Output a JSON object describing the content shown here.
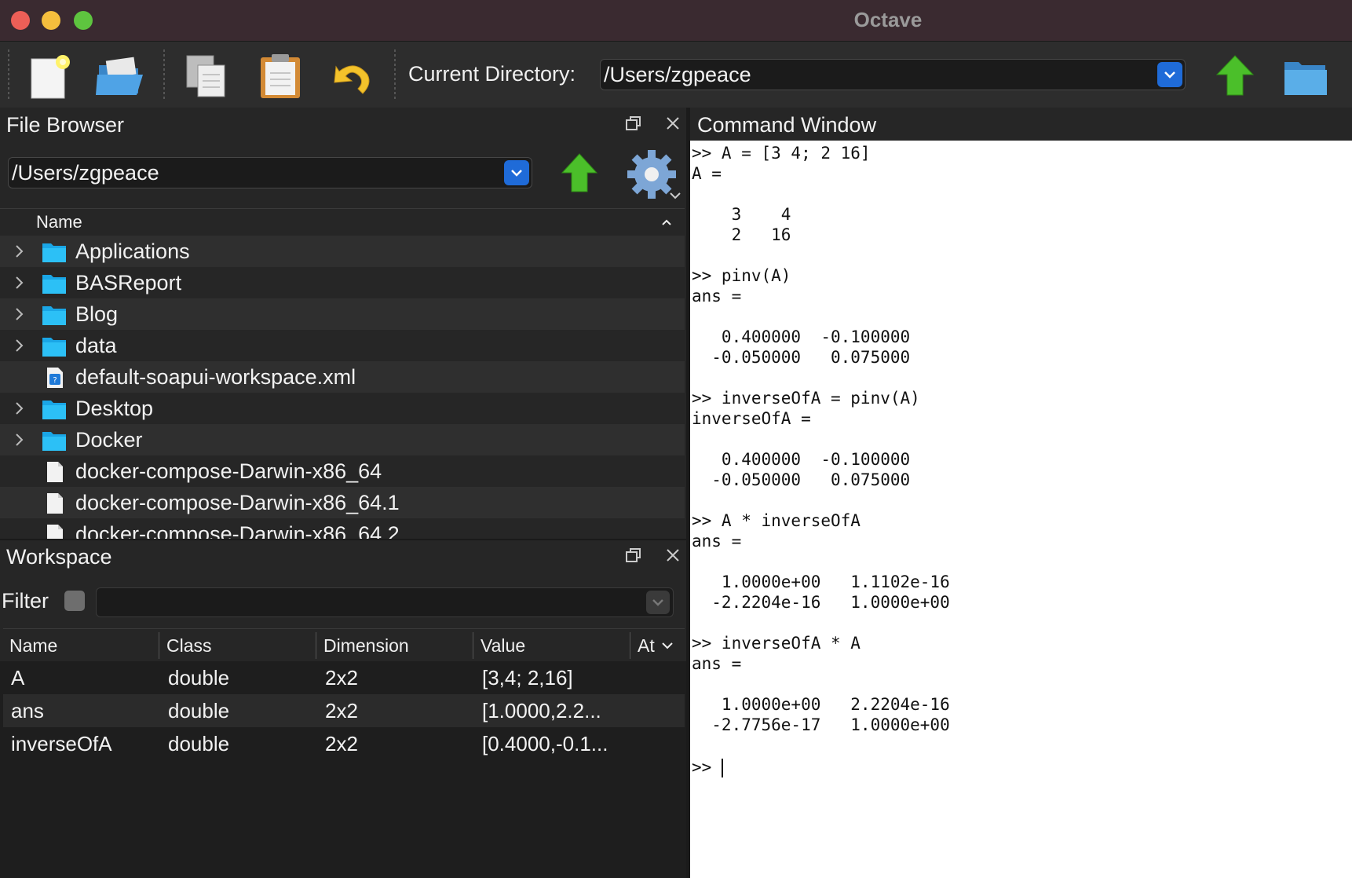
{
  "window": {
    "title": "Octave"
  },
  "toolbar": {
    "buttons": [
      "new-script",
      "open-file",
      "copy",
      "paste",
      "undo"
    ],
    "current_directory_label": "Current Directory:",
    "current_directory_value": "/Users/zgpeace"
  },
  "file_browser": {
    "title": "File Browser",
    "path": "/Users/zgpeace",
    "column_name": "Name",
    "items": [
      {
        "label": "Applications",
        "type": "folder"
      },
      {
        "label": "BASReport",
        "type": "folder"
      },
      {
        "label": "Blog",
        "type": "folder"
      },
      {
        "label": "data",
        "type": "folder"
      },
      {
        "label": "default-soapui-workspace.xml",
        "type": "xml-file"
      },
      {
        "label": "Desktop",
        "type": "folder"
      },
      {
        "label": "Docker",
        "type": "folder"
      },
      {
        "label": "docker-compose-Darwin-x86_64",
        "type": "file"
      },
      {
        "label": "docker-compose-Darwin-x86_64.1",
        "type": "file"
      },
      {
        "label": "docker-compose-Darwin-x86_64.2",
        "type": "file"
      }
    ]
  },
  "workspace": {
    "title": "Workspace",
    "filter_label": "Filter",
    "filter_value": "",
    "columns": [
      "Name",
      "Class",
      "Dimension",
      "Value",
      "At"
    ],
    "rows": [
      {
        "name": "A",
        "class": "double",
        "dimension": "2x2",
        "value": "[3,4; 2,16]"
      },
      {
        "name": "ans",
        "class": "double",
        "dimension": "2x2",
        "value": "[1.0000,2.2..."
      },
      {
        "name": "inverseOfA",
        "class": "double",
        "dimension": "2x2",
        "value": "[0.4000,-0.1..."
      }
    ]
  },
  "command_window": {
    "title": "Command Window",
    "lines": [
      ">> A = [3 4; 2 16]",
      "A =",
      "",
      "    3    4",
      "    2   16",
      "",
      ">> pinv(A)",
      "ans =",
      "",
      "   0.400000  -0.100000",
      "  -0.050000   0.075000",
      "",
      ">> inverseOfA = pinv(A)",
      "inverseOfA =",
      "",
      "   0.400000  -0.100000",
      "  -0.050000   0.075000",
      "",
      ">> A * inverseOfA",
      "ans =",
      "",
      "   1.0000e+00   1.1102e-16",
      "  -2.2204e-16   1.0000e+00",
      "",
      ">> inverseOfA * A",
      "ans =",
      "",
      "   1.0000e+00   2.2204e-16",
      "  -2.7756e-17   1.0000e+00",
      ""
    ],
    "prompt": ">> "
  }
}
